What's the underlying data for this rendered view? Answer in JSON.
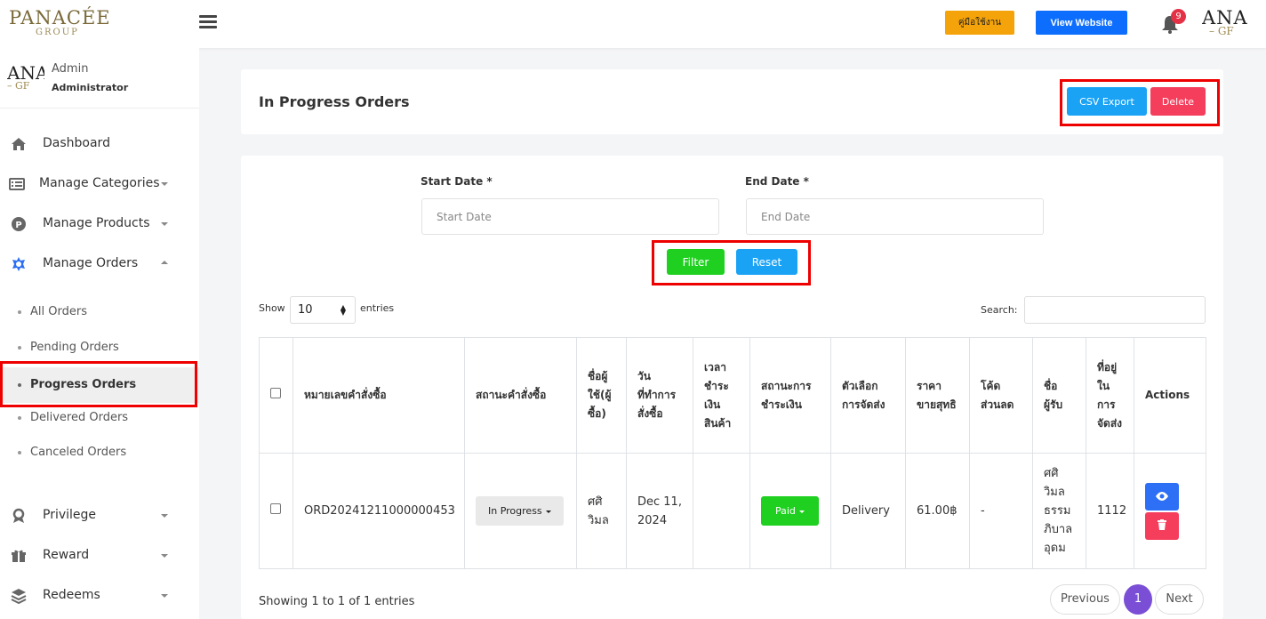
{
  "brand": {
    "logo_text": "PANACÉE",
    "logo_sub": "GROUP",
    "avatar_text": "ANA",
    "avatar_sub": "– GF"
  },
  "topbar": {
    "manual_label": "คู่มือใช้งาน",
    "view_website_label": "View Website",
    "notification_count": "9"
  },
  "user": {
    "name": "Admin",
    "role": "Administrator"
  },
  "sidebar": {
    "items": [
      {
        "label": "Dashboard"
      },
      {
        "label": "Manage Categories"
      },
      {
        "label": "Manage Products"
      },
      {
        "label": "Manage Orders"
      },
      {
        "label": "Privilege"
      },
      {
        "label": "Reward"
      },
      {
        "label": "Redeems"
      }
    ],
    "order_subitems": [
      {
        "label": "All Orders"
      },
      {
        "label": "Pending Orders"
      },
      {
        "label": "Progress Orders"
      },
      {
        "label": "Delivered Orders"
      },
      {
        "label": "Canceled Orders"
      }
    ]
  },
  "header": {
    "title": "In Progress Orders",
    "csv_label": "CSV Export",
    "delete_label": "Delete"
  },
  "filter": {
    "start_label": "Start Date *",
    "start_placeholder": "Start Date",
    "end_label": "End Date *",
    "end_placeholder": "End Date",
    "filter_label": "Filter",
    "reset_label": "Reset"
  },
  "table_controls": {
    "show_label": "Show",
    "entries_value": "10",
    "entries_label": "entries",
    "search_label": "Search:"
  },
  "table": {
    "headers": [
      "หมายเลขคำสั่งซื้อ",
      "สถานะคำสั่งซื้อ",
      "ชื่อผู้ใช้(ผู้ซื้อ)",
      "วันที่ทำการสั่งซื้อ",
      "เวลาชำระเงินสินค้า",
      "สถานะการชำระเงิน",
      "ตัวเลือกการจัดส่ง",
      "ราคาขายสุทธิ",
      "โค้ดส่วนลด",
      "ชื่อผู้รับ",
      "ที่อยู่ในการจัดส่ง",
      "Actions"
    ],
    "rows": [
      {
        "order_no": "ORD20241211000000453",
        "status": "In Progress",
        "buyer": "ศศิ วิมล",
        "order_date": "Dec 11, 2024",
        "pay_time": "",
        "pay_status": "Paid",
        "delivery": "Delivery",
        "net_price": "61.00฿",
        "discount": "-",
        "recipient": "ศศิ วิมล ธรรมภิบาล อุดม",
        "address": "1112"
      }
    ]
  },
  "footer": {
    "info": "Showing 1 to 1 of 1 entries",
    "prev_label": "Previous",
    "page": "1",
    "next_label": "Next"
  }
}
